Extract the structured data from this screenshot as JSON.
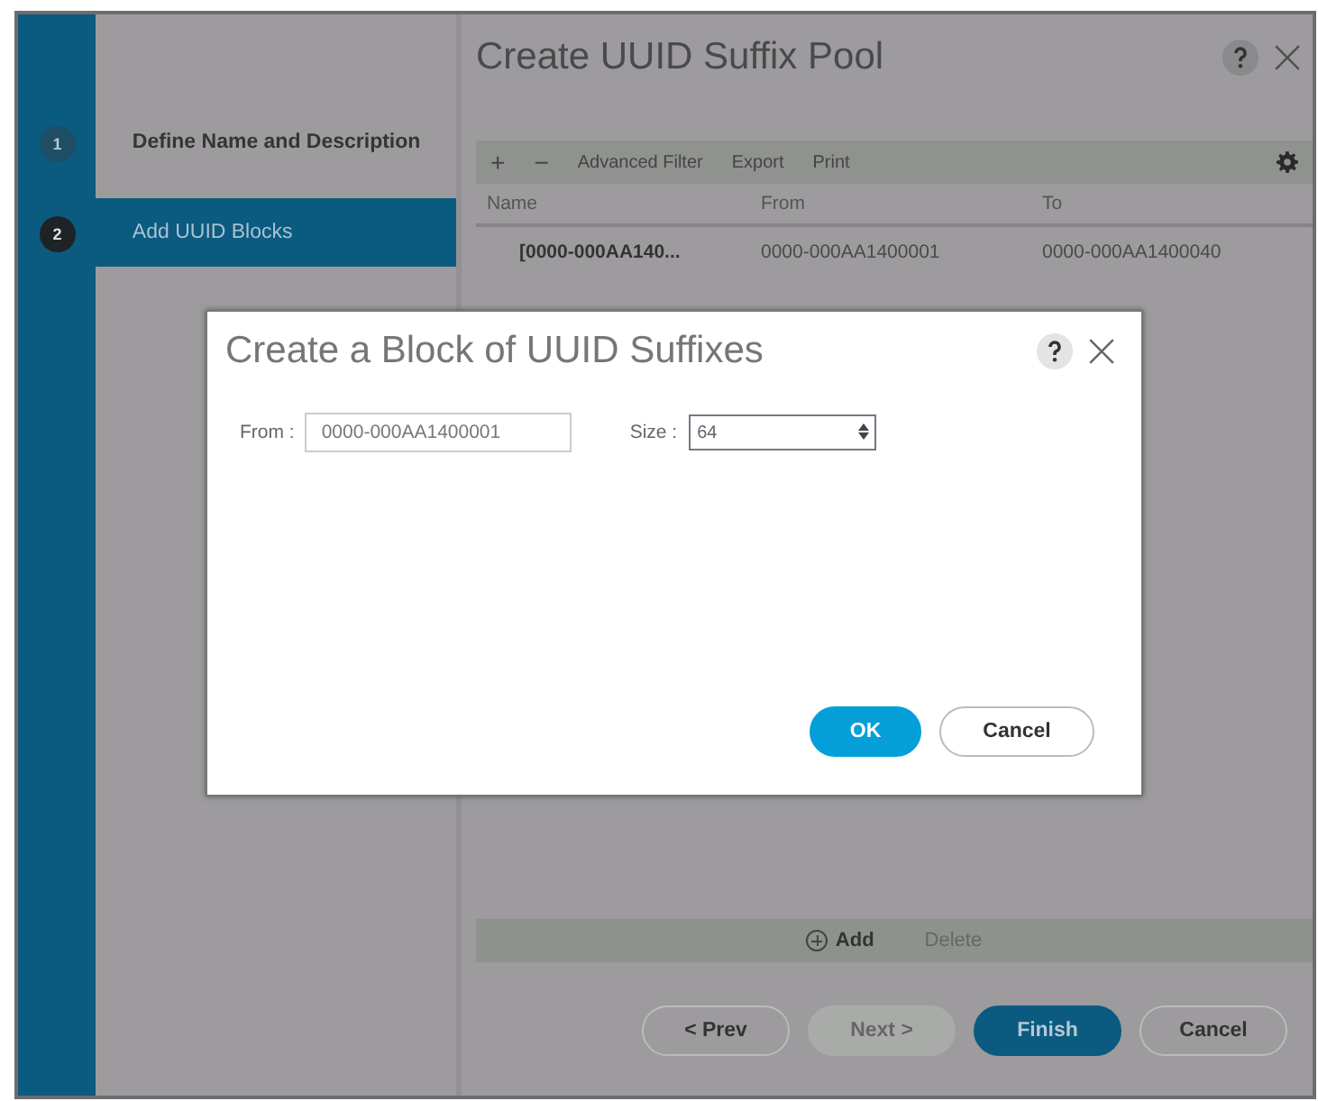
{
  "wizard": {
    "title": "Create UUID Suffix Pool",
    "steps": [
      {
        "number": "1",
        "label": "Define Name and Description",
        "selected": false
      },
      {
        "number": "2",
        "label": "Add UUID Blocks",
        "selected": true
      }
    ],
    "toolbar": [
      {
        "kind": "add",
        "label": "+"
      },
      {
        "kind": "remove",
        "label": "−"
      },
      {
        "kind": "filter",
        "label": "Advanced Filter"
      },
      {
        "kind": "export",
        "label": "Export"
      },
      {
        "kind": "print",
        "label": "Print"
      }
    ],
    "table": {
      "columns": [
        "Name",
        "From",
        "To"
      ],
      "rows": [
        [
          "[0000-000AA140...",
          "0000-000AA1400001",
          "0000-000AA1400040"
        ]
      ]
    },
    "actions": [
      {
        "kind": "add",
        "label": "Add",
        "disabled": false
      },
      {
        "kind": "delete",
        "label": "Delete",
        "disabled": true
      }
    ],
    "buttons": [
      {
        "label": "< Prev",
        "kind": "normal",
        "disabled": false
      },
      {
        "label": "Next >",
        "kind": "normal",
        "disabled": true
      },
      {
        "label": "Finish",
        "kind": "primary",
        "disabled": false
      },
      {
        "label": "Cancel",
        "kind": "normal",
        "disabled": false
      }
    ]
  },
  "dialog": {
    "title": "Create a Block of UUID Suffixes",
    "from_label": "From :",
    "from_value": "0000-000AA1400001",
    "size_label": "Size :",
    "size_value": "64",
    "buttons": [
      {
        "label": "OK",
        "kind": "primary"
      },
      {
        "label": "Cancel",
        "kind": "normal"
      }
    ]
  }
}
